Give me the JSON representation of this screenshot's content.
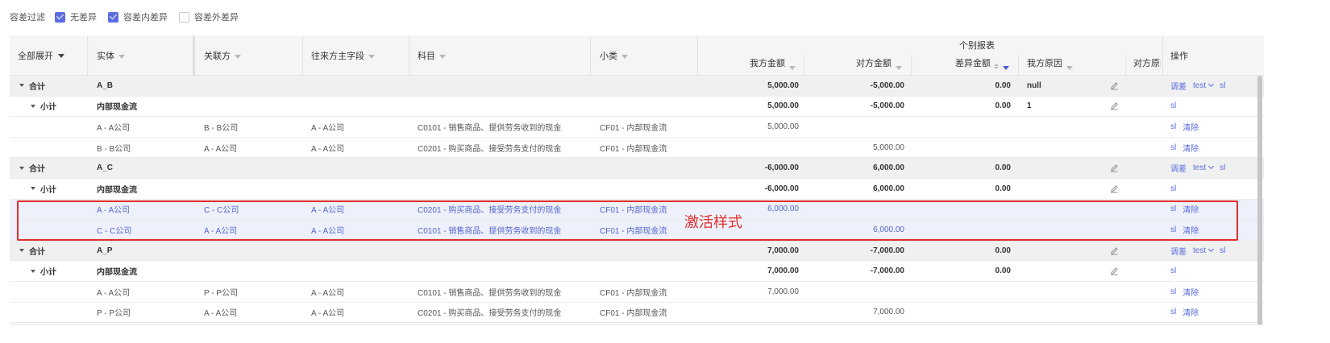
{
  "filter": {
    "label": "容差过滤",
    "options": [
      {
        "label": "无差异",
        "checked": true
      },
      {
        "label": "容差内差异",
        "checked": true
      },
      {
        "label": "容差外差异",
        "checked": false
      }
    ]
  },
  "header": {
    "expand_all": "全部展开",
    "entity": "实体",
    "related": "关联方",
    "counterpart_field": "往来方主字段",
    "account": "科目",
    "subcategory": "小类",
    "group_title": "个别报表",
    "our_amount": "我方金额",
    "their_amount": "对方金额",
    "diff_amount": "差异金额",
    "our_reason": "我方原因",
    "their_reason": "对方原因",
    "ops": "操作"
  },
  "rows": [
    {
      "type": "total",
      "label": "合计",
      "entity": "A_B",
      "related": "",
      "cp": "",
      "account": "",
      "sub": "",
      "our": "5,000.00",
      "their": "-5,000.00",
      "diff": "0.00",
      "reason": "null",
      "edit": true,
      "ops": [
        "调差",
        "test",
        "sl"
      ]
    },
    {
      "type": "subtotal",
      "label": "小计",
      "entity": "内部现金流",
      "related": "",
      "cp": "",
      "account": "",
      "sub": "",
      "our": "5,000.00",
      "their": "-5,000.00",
      "diff": "0.00",
      "reason": "1",
      "edit": true,
      "ops": [
        "sl"
      ]
    },
    {
      "type": "detail",
      "label": "",
      "entity": "A - A公司",
      "related": "B - B公司",
      "cp": "A - A公司",
      "account": "C0101 - 销售商品、提供劳务收到的现金",
      "sub": "CF01 - 内部现金流",
      "our": "5,000.00",
      "their": "",
      "diff": "",
      "reason": "",
      "edit": false,
      "ops": [
        "sl",
        "清除"
      ]
    },
    {
      "type": "detail",
      "label": "",
      "entity": "B - B公司",
      "related": "A - A公司",
      "cp": "A - A公司",
      "account": "C0201 - 购买商品、接受劳务支付的现金",
      "sub": "CF01 - 内部现金流",
      "our": "",
      "their": "5,000.00",
      "diff": "",
      "reason": "",
      "edit": false,
      "ops": [
        "sl",
        "清除"
      ]
    },
    {
      "type": "total",
      "label": "合计",
      "entity": "A_C",
      "related": "",
      "cp": "",
      "account": "",
      "sub": "",
      "our": "-6,000.00",
      "their": "6,000.00",
      "diff": "0.00",
      "reason": "",
      "edit": true,
      "ops": [
        "调差",
        "test",
        "sl"
      ]
    },
    {
      "type": "subtotal",
      "label": "小计",
      "entity": "内部现金流",
      "related": "",
      "cp": "",
      "account": "",
      "sub": "",
      "our": "-6,000.00",
      "their": "6,000.00",
      "diff": "0.00",
      "reason": "",
      "edit": true,
      "ops": [
        "sl"
      ]
    },
    {
      "type": "active",
      "label": "",
      "entity": "A - A公司",
      "related": "C - C公司",
      "cp": "A - A公司",
      "account": "C0201 - 购买商品、接受劳务支付的现金",
      "sub": "CF01 - 内部现金流",
      "our": "6,000.00",
      "their": "",
      "diff": "",
      "reason": "",
      "edit": false,
      "ops": [
        "sl",
        "清除"
      ]
    },
    {
      "type": "active",
      "label": "",
      "entity": "C - C公司",
      "related": "A - A公司",
      "cp": "A - A公司",
      "account": "C0101 - 销售商品、提供劳务收到的现金",
      "sub": "CF01 - 内部现金流",
      "our": "",
      "their": "6,000.00",
      "diff": "",
      "reason": "",
      "edit": false,
      "ops": [
        "sl",
        "清除"
      ]
    },
    {
      "type": "total",
      "label": "合计",
      "entity": "A_P",
      "related": "",
      "cp": "",
      "account": "",
      "sub": "",
      "our": "7,000.00",
      "their": "-7,000.00",
      "diff": "0.00",
      "reason": "",
      "edit": true,
      "ops": [
        "调差",
        "test",
        "sl"
      ]
    },
    {
      "type": "subtotal",
      "label": "小计",
      "entity": "内部现金流",
      "related": "",
      "cp": "",
      "account": "",
      "sub": "",
      "our": "7,000.00",
      "their": "-7,000.00",
      "diff": "0.00",
      "reason": "",
      "edit": true,
      "ops": [
        "sl"
      ]
    },
    {
      "type": "detail",
      "label": "",
      "entity": "A - A公司",
      "related": "P - P公司",
      "cp": "A - A公司",
      "account": "C0101 - 销售商品、提供劳务收到的现金",
      "sub": "CF01 - 内部现金流",
      "our": "7,000.00",
      "their": "",
      "diff": "",
      "reason": "",
      "edit": false,
      "ops": [
        "sl",
        "清除"
      ]
    },
    {
      "type": "detail",
      "label": "",
      "entity": "P - P公司",
      "related": "A - A公司",
      "cp": "A - A公司",
      "account": "C0201 - 购买商品、接受劳务支付的现金",
      "sub": "CF01 - 内部现金流",
      "our": "",
      "their": "7,000.00",
      "diff": "",
      "reason": "",
      "edit": false,
      "ops": [
        "sl",
        "清除"
      ]
    }
  ],
  "annotation": "激活样式",
  "colors": {
    "accent": "#5b6ee1",
    "highlight": "#e0302a",
    "active_row": "#eef0fb"
  }
}
